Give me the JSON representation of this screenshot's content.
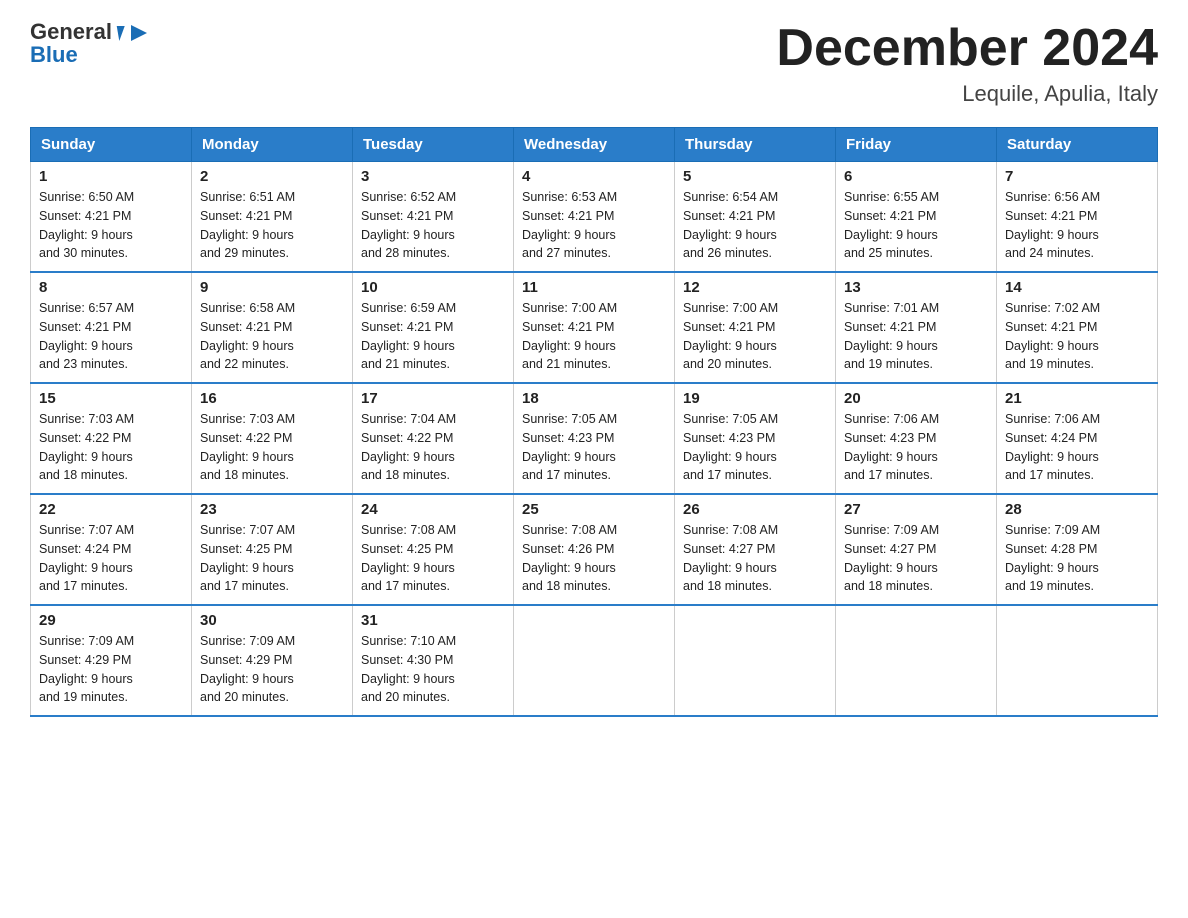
{
  "logo": {
    "line1": "General",
    "line2": "Blue"
  },
  "title": "December 2024",
  "subtitle": "Lequile, Apulia, Italy",
  "days_of_week": [
    "Sunday",
    "Monday",
    "Tuesday",
    "Wednesday",
    "Thursday",
    "Friday",
    "Saturday"
  ],
  "weeks": [
    [
      {
        "day": "1",
        "sunrise": "6:50 AM",
        "sunset": "4:21 PM",
        "daylight": "9 hours and 30 minutes."
      },
      {
        "day": "2",
        "sunrise": "6:51 AM",
        "sunset": "4:21 PM",
        "daylight": "9 hours and 29 minutes."
      },
      {
        "day": "3",
        "sunrise": "6:52 AM",
        "sunset": "4:21 PM",
        "daylight": "9 hours and 28 minutes."
      },
      {
        "day": "4",
        "sunrise": "6:53 AM",
        "sunset": "4:21 PM",
        "daylight": "9 hours and 27 minutes."
      },
      {
        "day": "5",
        "sunrise": "6:54 AM",
        "sunset": "4:21 PM",
        "daylight": "9 hours and 26 minutes."
      },
      {
        "day": "6",
        "sunrise": "6:55 AM",
        "sunset": "4:21 PM",
        "daylight": "9 hours and 25 minutes."
      },
      {
        "day": "7",
        "sunrise": "6:56 AM",
        "sunset": "4:21 PM",
        "daylight": "9 hours and 24 minutes."
      }
    ],
    [
      {
        "day": "8",
        "sunrise": "6:57 AM",
        "sunset": "4:21 PM",
        "daylight": "9 hours and 23 minutes."
      },
      {
        "day": "9",
        "sunrise": "6:58 AM",
        "sunset": "4:21 PM",
        "daylight": "9 hours and 22 minutes."
      },
      {
        "day": "10",
        "sunrise": "6:59 AM",
        "sunset": "4:21 PM",
        "daylight": "9 hours and 21 minutes."
      },
      {
        "day": "11",
        "sunrise": "7:00 AM",
        "sunset": "4:21 PM",
        "daylight": "9 hours and 21 minutes."
      },
      {
        "day": "12",
        "sunrise": "7:00 AM",
        "sunset": "4:21 PM",
        "daylight": "9 hours and 20 minutes."
      },
      {
        "day": "13",
        "sunrise": "7:01 AM",
        "sunset": "4:21 PM",
        "daylight": "9 hours and 19 minutes."
      },
      {
        "day": "14",
        "sunrise": "7:02 AM",
        "sunset": "4:21 PM",
        "daylight": "9 hours and 19 minutes."
      }
    ],
    [
      {
        "day": "15",
        "sunrise": "7:03 AM",
        "sunset": "4:22 PM",
        "daylight": "9 hours and 18 minutes."
      },
      {
        "day": "16",
        "sunrise": "7:03 AM",
        "sunset": "4:22 PM",
        "daylight": "9 hours and 18 minutes."
      },
      {
        "day": "17",
        "sunrise": "7:04 AM",
        "sunset": "4:22 PM",
        "daylight": "9 hours and 18 minutes."
      },
      {
        "day": "18",
        "sunrise": "7:05 AM",
        "sunset": "4:23 PM",
        "daylight": "9 hours and 17 minutes."
      },
      {
        "day": "19",
        "sunrise": "7:05 AM",
        "sunset": "4:23 PM",
        "daylight": "9 hours and 17 minutes."
      },
      {
        "day": "20",
        "sunrise": "7:06 AM",
        "sunset": "4:23 PM",
        "daylight": "9 hours and 17 minutes."
      },
      {
        "day": "21",
        "sunrise": "7:06 AM",
        "sunset": "4:24 PM",
        "daylight": "9 hours and 17 minutes."
      }
    ],
    [
      {
        "day": "22",
        "sunrise": "7:07 AM",
        "sunset": "4:24 PM",
        "daylight": "9 hours and 17 minutes."
      },
      {
        "day": "23",
        "sunrise": "7:07 AM",
        "sunset": "4:25 PM",
        "daylight": "9 hours and 17 minutes."
      },
      {
        "day": "24",
        "sunrise": "7:08 AM",
        "sunset": "4:25 PM",
        "daylight": "9 hours and 17 minutes."
      },
      {
        "day": "25",
        "sunrise": "7:08 AM",
        "sunset": "4:26 PM",
        "daylight": "9 hours and 18 minutes."
      },
      {
        "day": "26",
        "sunrise": "7:08 AM",
        "sunset": "4:27 PM",
        "daylight": "9 hours and 18 minutes."
      },
      {
        "day": "27",
        "sunrise": "7:09 AM",
        "sunset": "4:27 PM",
        "daylight": "9 hours and 18 minutes."
      },
      {
        "day": "28",
        "sunrise": "7:09 AM",
        "sunset": "4:28 PM",
        "daylight": "9 hours and 19 minutes."
      }
    ],
    [
      {
        "day": "29",
        "sunrise": "7:09 AM",
        "sunset": "4:29 PM",
        "daylight": "9 hours and 19 minutes."
      },
      {
        "day": "30",
        "sunrise": "7:09 AM",
        "sunset": "4:29 PM",
        "daylight": "9 hours and 20 minutes."
      },
      {
        "day": "31",
        "sunrise": "7:10 AM",
        "sunset": "4:30 PM",
        "daylight": "9 hours and 20 minutes."
      },
      null,
      null,
      null,
      null
    ]
  ],
  "labels": {
    "sunrise": "Sunrise: ",
    "sunset": "Sunset: ",
    "daylight": "Daylight: "
  }
}
